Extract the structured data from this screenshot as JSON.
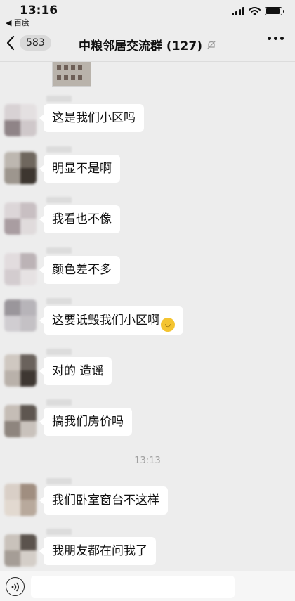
{
  "status_bar": {
    "time": "13:16",
    "back_app": "◀ 百度",
    "battery_level": 0.9
  },
  "nav": {
    "unread_count": "583",
    "title": "中粮邻居交流群 (127)",
    "muted": true
  },
  "messages": [
    {
      "text": "这是我们小区吗"
    },
    {
      "text": "明显不是啊"
    },
    {
      "text": "我看也不像"
    },
    {
      "text": "颜色差不多"
    },
    {
      "text": "这要诋毁我们小区啊",
      "emoji": "tears-of-joy"
    },
    {
      "text": "对的 造谣"
    },
    {
      "text": "搞我们房价吗"
    },
    {
      "text": "我们卧室窗台不这样"
    },
    {
      "text": "我朋友都在问我了"
    }
  ],
  "timestamp": "13:13",
  "colors": {
    "background": "#ededed",
    "bubble": "#ffffff",
    "timestamp": "#a0a0a0"
  }
}
